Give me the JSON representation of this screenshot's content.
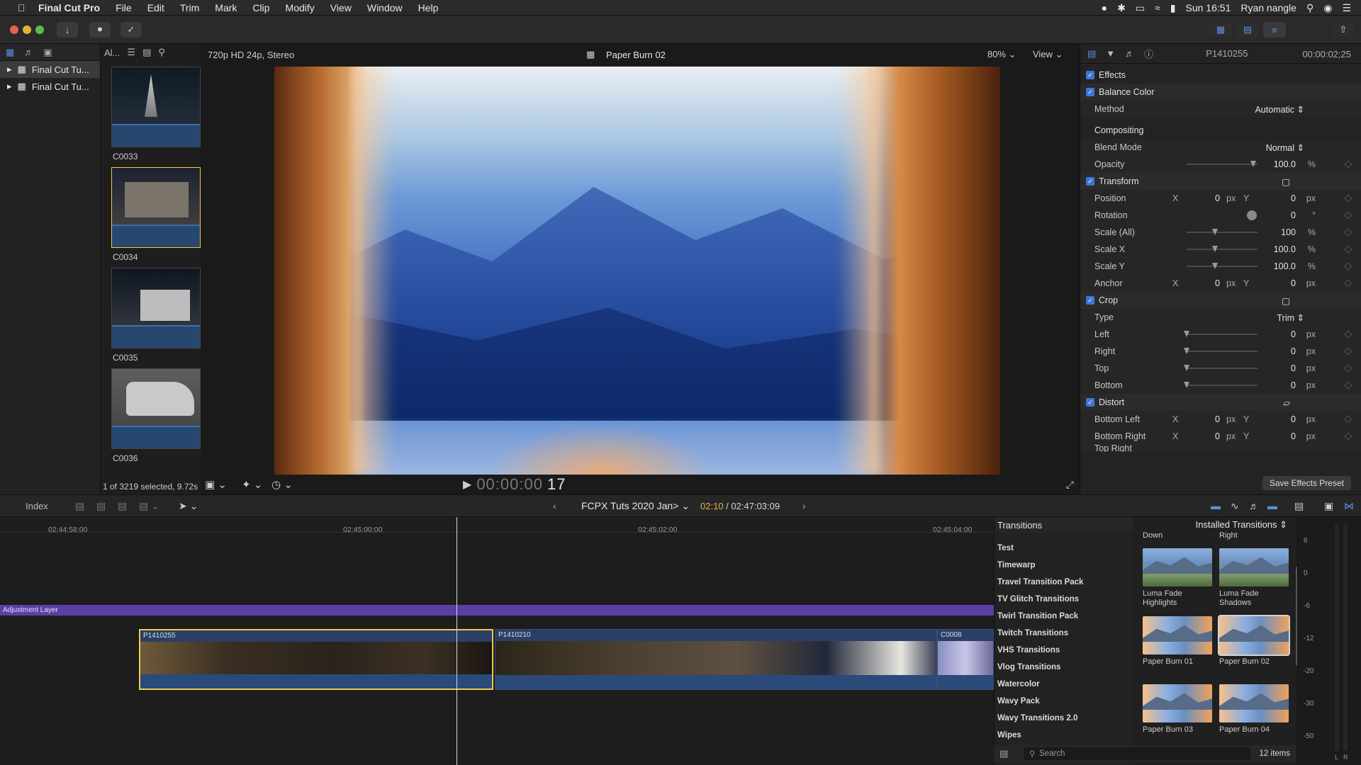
{
  "menubar": {
    "app": "Final Cut Pro",
    "items": [
      "File",
      "Edit",
      "Trim",
      "Mark",
      "Clip",
      "Modify",
      "View",
      "Window",
      "Help"
    ],
    "clock": "Sun 16:51",
    "user": "Ryan nangle"
  },
  "libraries": {
    "filter": "Al...",
    "items": [
      "Final Cut Tu...",
      "Final Cut Tu..."
    ]
  },
  "browser": {
    "clips": [
      "C0033",
      "C0034",
      "C0035",
      "C0036"
    ],
    "status": "1 of 3219 selected, 9.72s"
  },
  "viewer": {
    "format": "720p HD 24p, Stereo",
    "clip_title": "Paper Burn 02",
    "zoom": "80%",
    "view": "View",
    "timecode_dim": "00:00:00",
    "timecode_frames": "17"
  },
  "inspector": {
    "clip": "P1410255",
    "duration": "00:00:02;25",
    "effects_label": "Effects",
    "balance_color": "Balance Color",
    "method_label": "Method",
    "method_value": "Automatic",
    "compositing": "Compositing",
    "blend_label": "Blend Mode",
    "blend_value": "Normal",
    "opacity_label": "Opacity",
    "opacity_value": "100.0",
    "transform": "Transform",
    "position_label": "Position",
    "rotation_label": "Rotation",
    "scale_all_label": "Scale (All)",
    "scale_all_value": "100",
    "scale_x_label": "Scale X",
    "scale_x_value": "100.0",
    "scale_y_label": "Scale Y",
    "scale_y_value": "100.0",
    "anchor_label": "Anchor",
    "crop": "Crop",
    "type_label": "Type",
    "type_value": "Trim",
    "left_label": "Left",
    "right_label": "Right",
    "top_label": "Top",
    "bottom_label": "Bottom",
    "distort": "Distort",
    "bottom_left_label": "Bottom Left",
    "bottom_right_label": "Bottom Right",
    "top_right_label": "Top Right",
    "zero": "0",
    "px": "px",
    "percent": "%",
    "degree": "°",
    "x": "X",
    "y": "Y",
    "save_preset": "Save Effects Preset"
  },
  "timeline_bar": {
    "index": "Index",
    "project": "FCPX Tuts 2020 Jan>",
    "current": "02:10",
    "total": "02:47:03:09"
  },
  "timeline": {
    "ticks": [
      "02:44:58:00",
      "02:45:00:00",
      "02:45:02:00",
      "02:45:04:00"
    ],
    "adjustment_layer": "Adjustment Layer",
    "clips": [
      "P1410255",
      "P1410210",
      "C0008"
    ]
  },
  "transitions": {
    "title": "Transitions",
    "source": "Installed Transitions",
    "categories": [
      "Test",
      "Timewarp",
      "Travel Transition Pack",
      "TV Glitch Transitions",
      "Twirl Transition Pack",
      "Twitch Transitions",
      "VHS Transitions",
      "Vlog Transitions",
      "Watercolor",
      "Wavy Pack",
      "Wavy Transitions 2.0",
      "Wipes"
    ],
    "top_labels": [
      "Down",
      "Right"
    ],
    "tiles": [
      "Luma Fade Highlights",
      "Luma Fade Shadows",
      "Paper Burn 01",
      "Paper Burn 02",
      "Paper Burn 03",
      "Paper Burn 04"
    ],
    "search_placeholder": "Search",
    "count": "12 items"
  },
  "meters": {
    "labels": [
      "6",
      "0",
      "-6",
      "-12",
      "-20",
      "-30",
      "-50"
    ],
    "channels": [
      "L",
      "R"
    ]
  },
  "colors": {
    "accent": "#3b78d8",
    "selection": "#f2c94c",
    "adjustment": "#5b3fa3"
  }
}
